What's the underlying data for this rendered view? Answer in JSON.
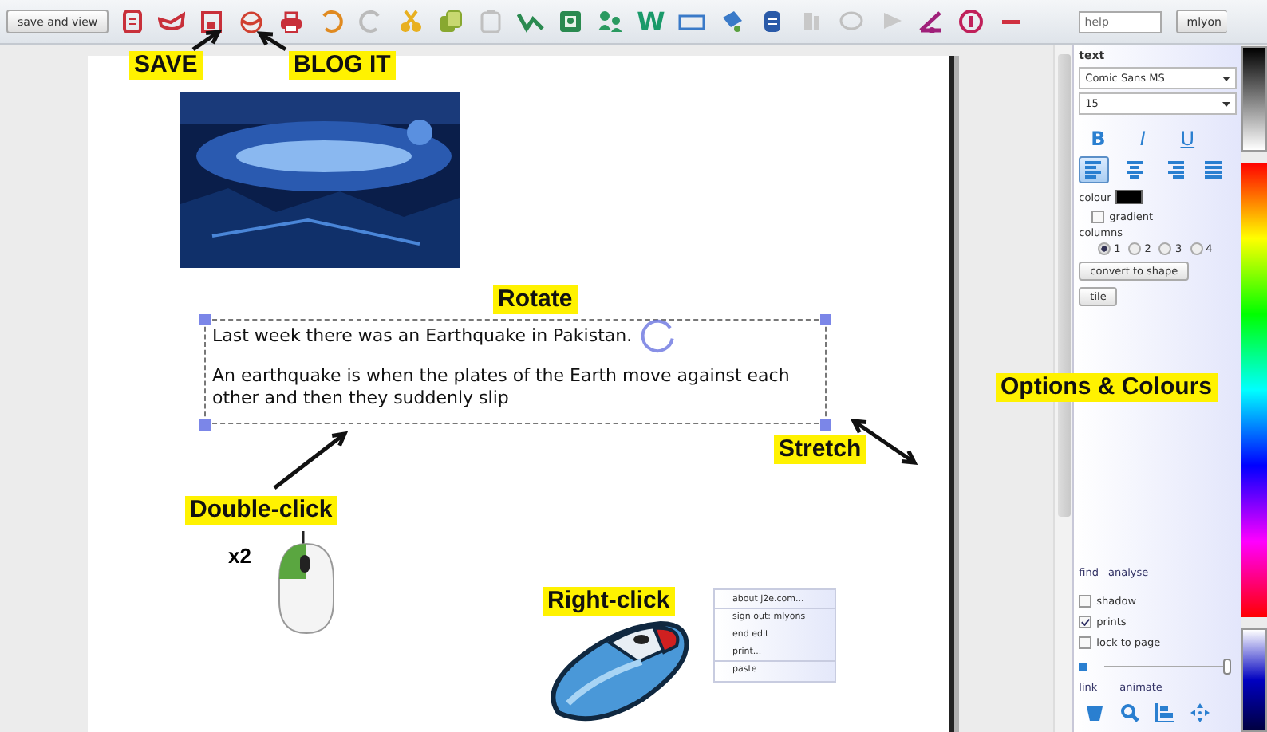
{
  "toolbar": {
    "save_view_button": "save and view",
    "word_tool": "W",
    "help_field": {
      "value": "help"
    },
    "user_button": "mlyon"
  },
  "document": {
    "text_box": {
      "selected": true,
      "paragraphs": [
        "Last week there was an Earthquake in Pakistan.",
        "An earthquake is when the plates of the Earth move against each other and then they suddenly slip"
      ]
    },
    "click_count": "x2",
    "context_menu": [
      {
        "label": "about j2e.com...",
        "separator": true
      },
      {
        "label": "sign out: mlyons",
        "separator": false
      },
      {
        "label": "end edit",
        "separator": false
      },
      {
        "label": "print...",
        "separator": true
      },
      {
        "label": "paste",
        "separator": false
      }
    ]
  },
  "properties_panel": {
    "title": "text",
    "font": "Comic Sans MS",
    "size": "15",
    "styles": [
      {
        "label": "B",
        "kind": "bold"
      },
      {
        "label": "I",
        "kind": "italic"
      },
      {
        "label": "U",
        "kind": "underline"
      }
    ],
    "alignment": [
      {
        "kind": "left",
        "selected": true
      },
      {
        "kind": "center",
        "selected": false
      },
      {
        "kind": "right",
        "selected": false
      },
      {
        "kind": "justify",
        "selected": false
      }
    ],
    "colour_label": "colour",
    "gradient": {
      "label": "gradient",
      "checked": false
    },
    "columns_label": "columns",
    "columns": [
      {
        "label": "1",
        "selected": true
      },
      {
        "label": "2",
        "selected": false
      },
      {
        "label": "3",
        "selected": false
      },
      {
        "label": "4",
        "selected": false
      }
    ],
    "buttons": [
      "convert to shape",
      "tile"
    ],
    "links": [
      "find",
      "analyse"
    ],
    "options": [
      {
        "label": "shadow",
        "checked": false
      },
      {
        "label": "prints",
        "checked": true
      },
      {
        "label": "lock to page",
        "checked": false
      }
    ],
    "slider": {
      "level": 1
    },
    "bottom_links": [
      "link",
      "animate"
    ]
  },
  "annotations": [
    {
      "label": "SAVE"
    },
    {
      "label": "BLOG IT"
    },
    {
      "label": "Rotate"
    },
    {
      "label": "Options & Colours"
    },
    {
      "label": "Stretch"
    },
    {
      "label": "Double-click"
    },
    {
      "label": "Right-click"
    }
  ]
}
